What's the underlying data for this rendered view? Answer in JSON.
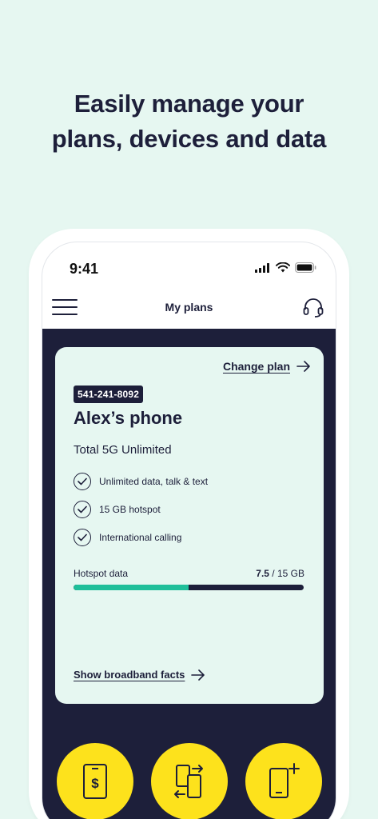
{
  "headline": {
    "line1": "Easily manage your",
    "line2": "plans, devices and data"
  },
  "status_bar": {
    "time": "9:41",
    "icons": [
      "cellular-signal-icon",
      "wifi-icon",
      "battery-icon"
    ]
  },
  "nav": {
    "title": "My plans",
    "menu_icon": "hamburger-menu-icon",
    "support_icon": "headset-icon"
  },
  "plan_card": {
    "change_plan_label": "Change plan",
    "phone_number": "541-241-8092",
    "device_name": "Alex’s phone",
    "plan_name": "Total 5G Unlimited",
    "features": [
      "Unlimited data, talk & text",
      "15 GB hotspot",
      "International calling"
    ],
    "hotspot": {
      "label": "Hotspot data",
      "used": "7.5",
      "total": " / 15 GB",
      "used_fraction": 0.5
    },
    "broadband_label": "Show broadband facts"
  },
  "actions": [
    "pay-bill-icon",
    "transfer-phone-icon",
    "add-device-icon"
  ],
  "colors": {
    "background": "#e6f7f1",
    "navy": "#1d1f3a",
    "teal": "#1fbf9a",
    "yellow": "#fde21c"
  }
}
